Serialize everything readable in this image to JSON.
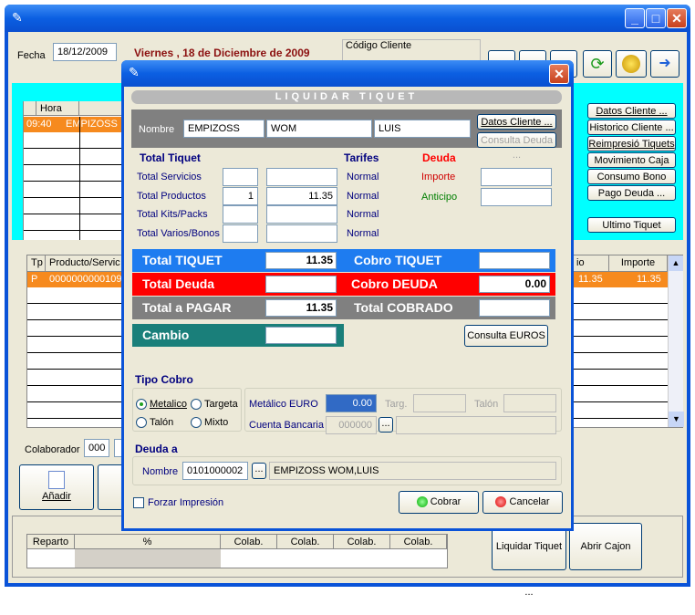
{
  "main": {
    "fecha_label": "Fecha",
    "fecha_value": "18/12/2009",
    "date_text": "Viernes , 18 de Diciembre de 2009",
    "codigo_cliente_label": "Código Cliente",
    "appointments_headers": [
      "Hora"
    ],
    "appointment_row": {
      "hora": "09:40",
      "cliente": "EMPIZOSS"
    },
    "right_buttons": [
      "Datos Cliente ...",
      "Historico Cliente ...",
      "Reimpresió Tiquets",
      "Movimiento Caja",
      "Consumo Bono",
      "Pago Deuda ...",
      "Ultimo Tiquet"
    ],
    "products_headers": {
      "tp": "Tp",
      "producto": "Producto/Servic",
      "precio": "io",
      "importe": "Importe"
    },
    "product_row": {
      "tp": "P",
      "producto": "0000000000109",
      "precio": "11.35",
      "importe": "11.35"
    },
    "colaborador_label": "Colaborador",
    "colaborador_value": "000",
    "anadir_label": "Añadir",
    "reparto_headers": [
      "Reparto",
      "%",
      "Colab.",
      "Colab.",
      "Colab.",
      "Colab."
    ],
    "liquidar_button": "Liquidar Tiquet ...",
    "abrir_cajon_button": "Abrir Cajon"
  },
  "dialog": {
    "banner": "LIQUIDAR TIQUET",
    "nombre_label": "Nombre",
    "nombre": [
      "EMPIZOSS",
      "WOM",
      "LUIS"
    ],
    "datos_cliente_btn": "Datos Cliente ...",
    "consulta_deuda_btn": "Consulta Deuda ...",
    "total_tiquet_title": "Total Tiquet",
    "tarifes_title": "Tarifes",
    "deuda_title": "Deuda",
    "rows": [
      {
        "label": "Total Servicios",
        "qty": "",
        "amount": "",
        "tarifa": "Normal"
      },
      {
        "label": "Total Productos",
        "qty": "1",
        "amount": "11.35",
        "tarifa": "Normal"
      },
      {
        "label": "Total Kits/Packs",
        "qty": "",
        "amount": "",
        "tarifa": "Normal"
      },
      {
        "label": "Total Varios/Bonos",
        "qty": "",
        "amount": "",
        "tarifa": "Normal"
      }
    ],
    "importe_label": "Importe",
    "anticipo_label": "Anticipo",
    "total_tiquet_label": "Total TIQUET",
    "total_tiquet_value": "11.35",
    "cobro_tiquet_label": "Cobro TIQUET",
    "cobro_tiquet_value": "",
    "total_deuda_label": "Total Deuda",
    "total_deuda_value": "",
    "cobro_deuda_label": "Cobro DEUDA",
    "cobro_deuda_value": "0.00",
    "total_pagar_label": "Total a PAGAR",
    "total_pagar_value": "11.35",
    "total_cobrado_label": "Total COBRADO",
    "total_cobrado_value": "",
    "cambio_label": "Cambio",
    "cambio_value": "",
    "consulta_euros_btn": "Consulta EUROS",
    "tipo_cobro_title": "Tipo Cobro",
    "tipo_options": [
      "Metalico",
      "Targeta",
      "Talón",
      "Mixto"
    ],
    "metalico_euro_label": "Metálico EURO",
    "metalico_euro_value": "0.00",
    "targ_label": "Targ.",
    "talon_label": "Talón",
    "cuenta_bancaria_label": "Cuenta Bancaria",
    "cuenta_bancaria_value": "000000",
    "deuda_a_title": "Deuda a",
    "deuda_nombre_label": "Nombre",
    "deuda_code": "0101000002",
    "deuda_name": "EMPIZOSS WOM,LUIS",
    "forzar_label": "Forzar Impresión",
    "cobrar_btn": "Cobrar",
    "cancelar_btn": "Cancelar"
  },
  "colors": {
    "titlebar": "#0a53d8",
    "accent_cyan": "#00ffff",
    "row_highlight": "#f68a1e",
    "deuda_red": "#ff0000",
    "total_blue": "#1e7cf0",
    "cambio_teal": "#1a7f7a"
  }
}
